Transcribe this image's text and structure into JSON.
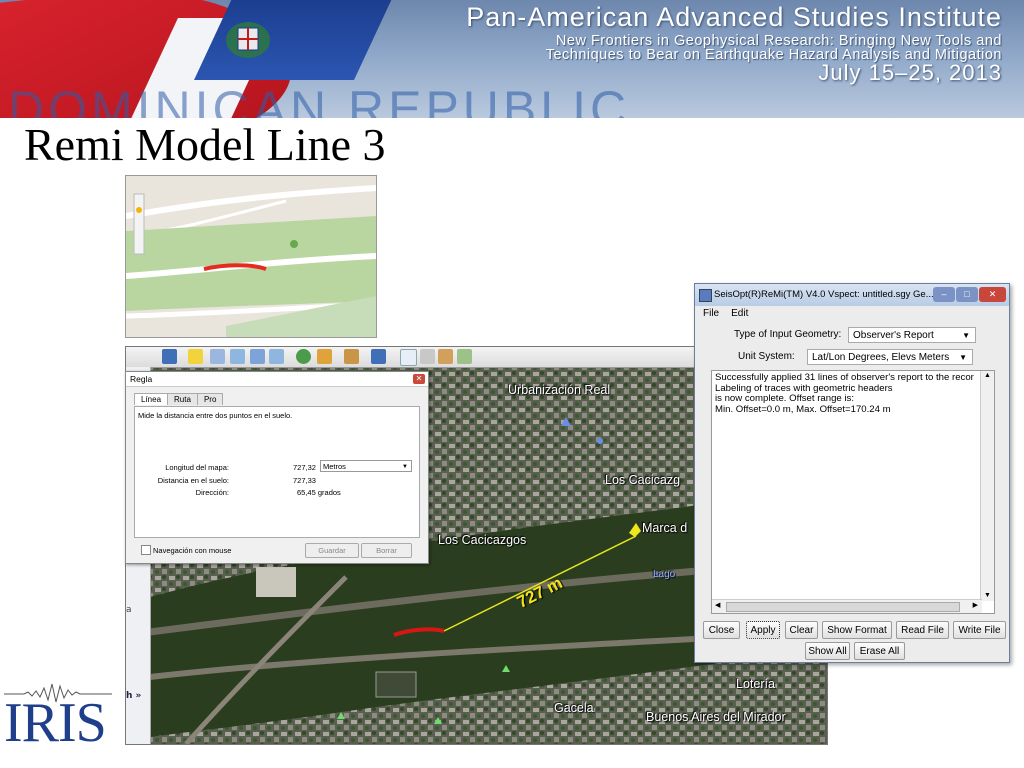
{
  "banner": {
    "title": "Pan-American Advanced Studies Institute",
    "subtitle_line1": "New Frontiers in Geophysical Research: Bringing New Tools and",
    "subtitle_line2": "Techniques to Bear on Earthquake Hazard Analysis and Mitigation",
    "date": "July 15–25, 2013",
    "country": "DOMINICAN REPUBLIC"
  },
  "slide": {
    "title": "Remi Model Line 3"
  },
  "measurement_label": "727 m",
  "regla": {
    "title": "Regla",
    "tabs": [
      "Línea",
      "Ruta",
      "Pro"
    ],
    "description": "Mide la distancia entre dos puntos en el suelo.",
    "map_length_label": "Longitud del mapa:",
    "map_length_value": "727,32",
    "unit_value": "Metros",
    "ground_distance_label": "Distancia en el suelo:",
    "ground_distance_value": "727,33",
    "direction_label": "Dirección:",
    "direction_value": "65,45 grados",
    "mouse_nav_label": "Navegación con mouse",
    "save_label": "Guardar",
    "clear_label": "Borrar"
  },
  "satellite_labels": {
    "urbanizacion": "Urbanización Real",
    "cacicazgos_right": "Los Cacicazg",
    "cacicazgos_left": "Los Cacicazgos",
    "marca": "Marca d",
    "lago": "Lago",
    "loteria": "Lotería",
    "gacela": "Gacela",
    "buenos_aires": "Buenos Aires del Mirador",
    "sidebar_more": "h »"
  },
  "seisopt": {
    "title": "SeisOpt(R)ReMi(TM) V4.0 Vspect: untitled.sgy Ge...",
    "menu": [
      "File",
      "Edit"
    ],
    "input_geometry_label": "Type of Input Geometry:",
    "input_geometry_value": "Observer's Report",
    "unit_system_label": "Unit System:",
    "unit_system_value": "Lat/Lon Degrees, Elevs Meters",
    "log_lines": [
      "Successfully applied 31 lines of observer's report to the recor",
      "Labeling of traces with geometric headers",
      "is now complete. Offset range is:",
      "Min. Offset=0.0 m, Max. Offset=170.24 m"
    ],
    "buttons": [
      "Close",
      "Apply",
      "Clear",
      "Show Format",
      "Read File",
      "Write File",
      "Show All",
      "Erase All"
    ]
  },
  "logo": {
    "text": "IRIS"
  },
  "colors": {
    "measure_line": "#e8e51c",
    "remi_line": "#d91616",
    "banner_blue": "#2e5da8"
  }
}
